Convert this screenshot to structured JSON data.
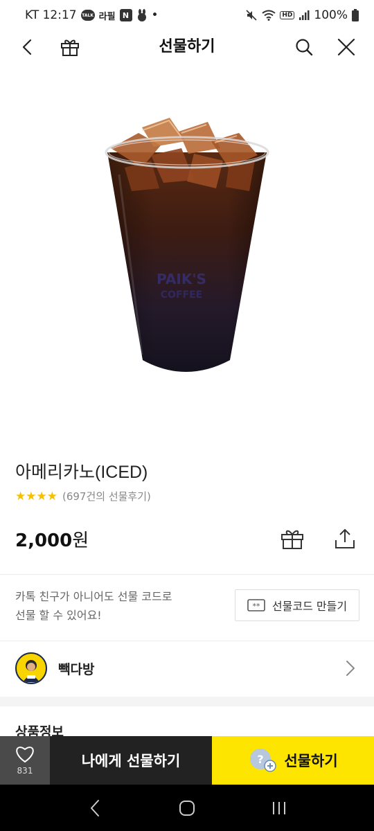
{
  "status_bar": {
    "carrier_time": "KT 12:17",
    "talk_badge": "TALK",
    "app_badge_text": "라필",
    "square_badge": "N",
    "dot": "•",
    "battery": "100%",
    "hd_badge": "HD"
  },
  "app_bar": {
    "title": "선물하기",
    "icons": [
      "back-arrow-icon",
      "gift-icon",
      "search-icon",
      "close-icon"
    ]
  },
  "product": {
    "name": "아메리카노(ICED)",
    "stars": "★★★★",
    "review_count": "(697건의 선물후기)",
    "price": "2,000",
    "price_unit": "원"
  },
  "gift_code": {
    "description": "카톡 친구가 아니어도 선물 코드로\n선물 할 수 있어요!",
    "button_label": "선물코드 만들기"
  },
  "brand": {
    "name": "빽다방"
  },
  "section": {
    "title": "상품정보"
  },
  "action_bar": {
    "like_count": "831",
    "gift_to_me_label": "나에게 선물하기",
    "gift_label": "선물하기"
  },
  "colors": {
    "accent_yellow": "#fee500",
    "dark_button": "#222222",
    "like_button": "#4a4a4a",
    "star": "#f5c000"
  }
}
